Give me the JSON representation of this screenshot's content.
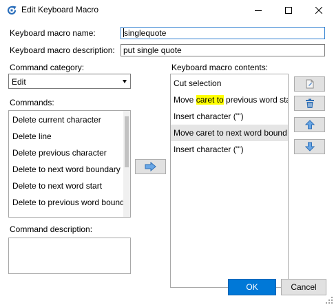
{
  "window": {
    "title": "Edit Keyboard Macro",
    "app_icon": "refresh-c-icon",
    "accent_color": "#2a6ebb"
  },
  "form": {
    "name_label": "Keyboard macro name:",
    "name_value": "singlequote",
    "description_label": "Keyboard macro description:",
    "description_value": "put single quote"
  },
  "command_category": {
    "label": "Command category:",
    "selected": "Edit"
  },
  "commands": {
    "label": "Commands:",
    "items": [
      "Delete current character",
      "Delete line",
      "Delete previous character",
      "Delete to next word boundary",
      "Delete to next word start",
      "Delete to previous word bound"
    ]
  },
  "command_description": {
    "label": "Command description:",
    "value": ""
  },
  "macro_contents": {
    "label": "Keyboard macro contents:",
    "items": [
      {
        "text": "Cut selection"
      },
      {
        "pre": "Move ",
        "highlight": "caret to",
        "post": " previous word sta"
      },
      {
        "text": "Insert character (''')"
      },
      {
        "text": "Move caret to next word bound",
        "selected": true
      },
      {
        "text": "Insert character (''')"
      }
    ],
    "highlight_color": "#ffff00",
    "selected_color": "#e5e5e5"
  },
  "buttons": {
    "add_icon": "arrow-right-icon",
    "new_icon": "new-document-icon",
    "delete_icon": "trash-icon",
    "up_icon": "arrow-up-icon",
    "down_icon": "arrow-down-icon",
    "ok": "OK",
    "cancel": "Cancel",
    "ok_color": "#0078d7"
  }
}
